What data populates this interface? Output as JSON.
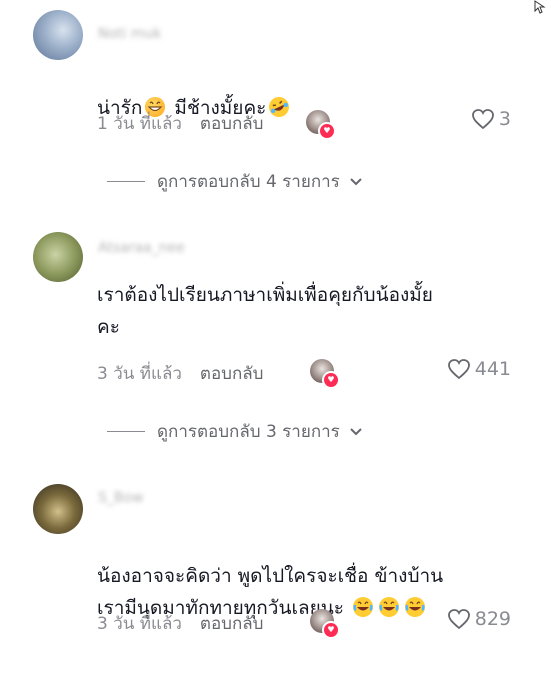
{
  "comments": [
    {
      "username": "Noti muk",
      "text_before": "น่ารัก",
      "text_after": " มีช้างมั้ยคะ",
      "time": "1 วัน ที่แล้ว",
      "reply_label": "ตอบกลับ",
      "likes": "3",
      "view_replies": "ดูการตอบกลับ 4 รายการ"
    },
    {
      "username": "Atsaraa_nee",
      "text": "เราต้องไปเรียนภาษาเพิ่มเพื่อคุยกับน้องมั้ย\nคะ",
      "time": "3 วัน ที่แล้ว",
      "reply_label": "ตอบกลับ",
      "likes": "441",
      "view_replies": "ดูการตอบกลับ 3 รายการ"
    },
    {
      "username": "S_Bow",
      "text": "น้องอาจจะคิดว่า พูดไปใครจะเชื่อ ข้างบ้าน\nเรามีนุดมาทักทายทุกวันเลยนะ ",
      "time": "3 วัน ที่แล้ว",
      "reply_label": "ตอบกลับ",
      "likes": "829"
    }
  ],
  "colors": {
    "accent": "#fe2c55",
    "meta": "#8a8b91",
    "text": "#161823"
  }
}
